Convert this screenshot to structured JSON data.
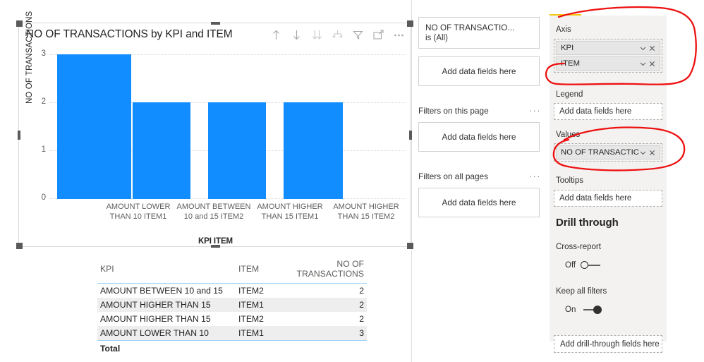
{
  "chart_visual": {
    "title": "NO OF TRANSACTIONS by KPI and ITEM",
    "header_icons": [
      {
        "name": "drill-up-icon",
        "label": "Drill up"
      },
      {
        "name": "drill-down-icon",
        "label": "Drill down"
      },
      {
        "name": "expand-next-level-icon",
        "label": "Go to the next level in the hierarchy"
      },
      {
        "name": "expand-all-down-icon",
        "label": "Expand all down one level in the hierarchy"
      },
      {
        "name": "filter-icon",
        "label": "Filters"
      },
      {
        "name": "focus-mode-icon",
        "label": "Focus mode"
      },
      {
        "name": "more-options-icon",
        "label": "More options"
      }
    ]
  },
  "chart_data": {
    "type": "bar",
    "title": "NO OF TRANSACTIONS by KPI and ITEM",
    "xlabel": "KPI ITEM",
    "ylabel": "NO OF TRANSACTIONS",
    "categories": [
      "AMOUNT LOWER THAN 10 ITEM1",
      "AMOUNT BETWEEN 10 and 15 ITEM2",
      "AMOUNT HIGHER THAN 15 ITEM1",
      "AMOUNT HIGHER THAN 15 ITEM2"
    ],
    "values": [
      3,
      2,
      2,
      2
    ],
    "yticks": [
      "0",
      "1",
      "2",
      "3"
    ],
    "ylim": [
      0,
      3
    ],
    "grid": true,
    "legend": "none",
    "bar_color": "#118DFF"
  },
  "table_visual": {
    "columns": [
      "KPI",
      "ITEM",
      "NO OF TRANSACTIONS"
    ],
    "rows": [
      {
        "kpi": "AMOUNT BETWEEN 10 and 15",
        "item": "ITEM2",
        "count": "2"
      },
      {
        "kpi": "AMOUNT HIGHER THAN 15",
        "item": "ITEM1",
        "count": "2"
      },
      {
        "kpi": "AMOUNT HIGHER THAN 15",
        "item": "ITEM2",
        "count": "2"
      },
      {
        "kpi": "AMOUNT LOWER THAN 10",
        "item": "ITEM1",
        "count": "3"
      }
    ],
    "total_label": "Total",
    "total_item": "",
    "total_count": ""
  },
  "filters_pane": {
    "visual_filter": {
      "field": "NO OF TRANSACTIO...",
      "condition": "is (All)"
    },
    "visual_add_zone": "Add data fields here",
    "page_filters_label": "Filters on this page",
    "page_filters_zone": "Add data fields here",
    "all_pages_filters_label": "Filters on all pages",
    "all_pages_filters_zone": "Add data fields here",
    "ellipsis": "···"
  },
  "viz_pane": {
    "axis_label": "Axis",
    "axis_fields": [
      "KPI",
      "ITEM"
    ],
    "legend_label": "Legend",
    "legend_placeholder": "Add data fields here",
    "values_label": "Values",
    "values_fields": [
      "NO OF TRANSACTIONS"
    ],
    "tooltips_label": "Tooltips",
    "tooltips_placeholder": "Add data fields here",
    "drill_through_header": "Drill through",
    "cross_report_label": "Cross-report",
    "cross_report_state": "Off",
    "keep_all_filters_label": "Keep all filters",
    "keep_all_filters_state": "On",
    "drill_add_placeholder": "Add drill-through fields here",
    "accent_color": "#f2c811"
  },
  "annotations": {
    "color": "#ee1111",
    "shapes": [
      "axis-section-circle",
      "values-section-circle"
    ]
  }
}
